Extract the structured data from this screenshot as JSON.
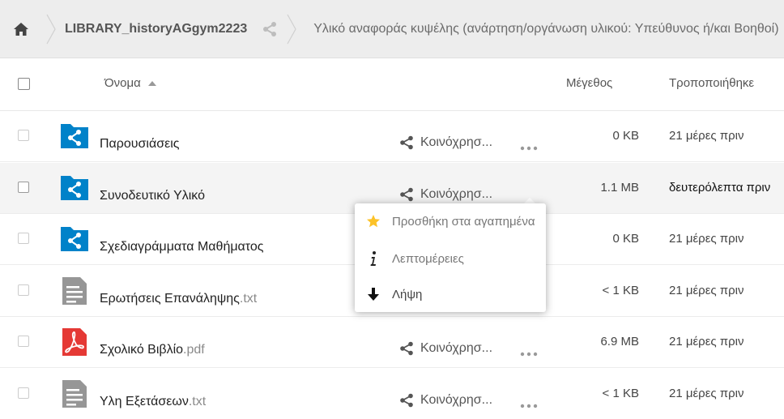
{
  "breadcrumb": {
    "library": "LIBRARY_historyAGgym2223",
    "current": "Υλικό αναφοράς κυψέλης (ανάρτηση/οργάνωση υλικού: Υπεύθυνος ή/και Βοηθοί)"
  },
  "header": {
    "name": "Όνομα",
    "size": "Μέγεθος",
    "modified": "Τροποποιήθηκε"
  },
  "share_label": "Κοινόχρησ...",
  "files": [
    {
      "name": "Παρουσιάσεις",
      "ext": "",
      "size": "0 KB",
      "modified": "21 μέρες πριν",
      "icon": "shared-folder-icon"
    },
    {
      "name": "Συνοδευτικό Υλικό",
      "ext": "",
      "size": "1.1 MB",
      "modified": "δευτερόλεπτα πριν",
      "icon": "shared-folder-icon"
    },
    {
      "name": "Σχεδιαγράμματα Μαθήματος",
      "ext": "",
      "size": "0 KB",
      "modified": "21 μέρες πριν",
      "icon": "shared-folder-icon"
    },
    {
      "name": "Ερωτήσεις Επανάληψης",
      "ext": ".txt",
      "size": "< 1 KB",
      "modified": "21 μέρες πριν",
      "icon": "text-file-icon"
    },
    {
      "name": "Σχολικό Βιβλίο",
      "ext": ".pdf",
      "size": "6.9 MB",
      "modified": "21 μέρες πριν",
      "icon": "pdf-file-icon"
    },
    {
      "name": "Υλη Εξετάσεων",
      "ext": ".txt",
      "size": "< 1 KB",
      "modified": "21 μέρες πριν",
      "icon": "text-file-icon"
    }
  ],
  "menu": {
    "favorite": "Προσθήκη στα αγαπημένα",
    "details": "Λεπτομέρειες",
    "download": "Λήψη"
  },
  "colors": {
    "folder_blue": "#0082c9",
    "pdf_red": "#e53935",
    "text_file_gray": "#969696",
    "star_yellow": "#fcc228"
  }
}
